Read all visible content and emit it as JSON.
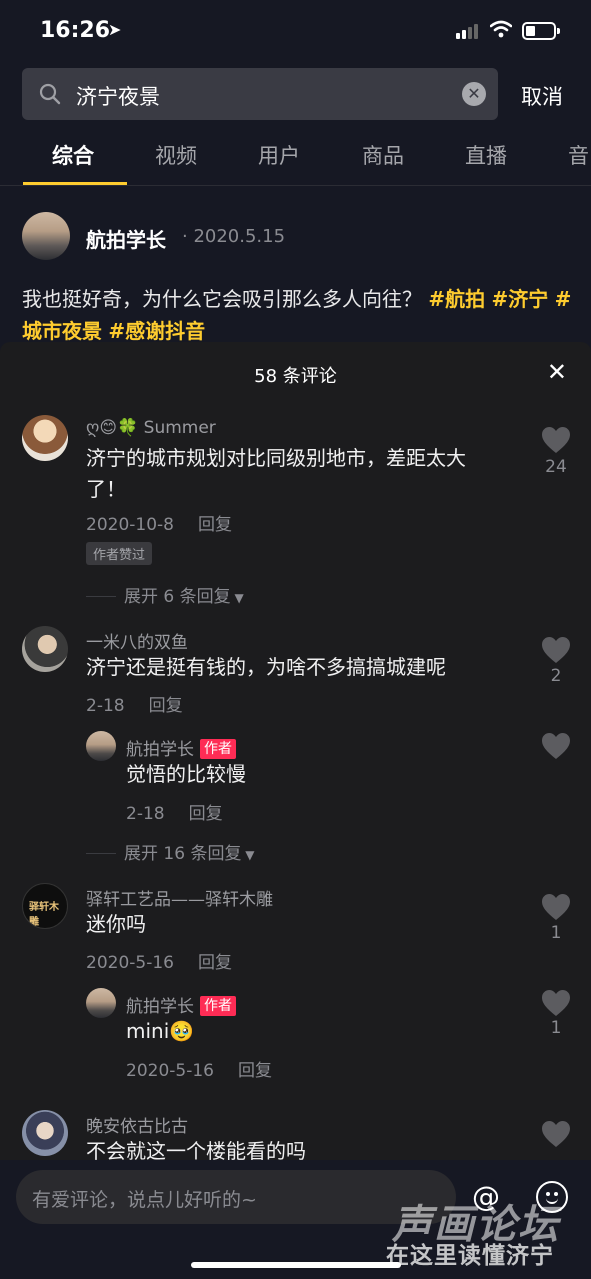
{
  "status_bar": {
    "time": "16:26"
  },
  "search": {
    "query": "济宁夜景",
    "cancel_label": "取消"
  },
  "tabs": [
    {
      "label": "综合",
      "active": true
    },
    {
      "label": "视频"
    },
    {
      "label": "用户"
    },
    {
      "label": "商品"
    },
    {
      "label": "直播"
    },
    {
      "label": "音"
    }
  ],
  "post": {
    "author": "航拍学长",
    "date": "· 2020.5.15",
    "text": "我也挺好奇，为什么它会吸引那么多人向往？",
    "tags": [
      "#航拍",
      "#济宁",
      "#城市夜景",
      "#感谢抖音"
    ]
  },
  "comments_sheet": {
    "title": "58 条评论",
    "comments": [
      {
        "user": "ღ😊🍀 Summer",
        "text_line1": "济宁的城市规划对比同级别地市，差距太大",
        "text_line2": "了！",
        "date": "2020-10-8",
        "reply_label": "回复",
        "badge": "作者赞过",
        "likes": "24",
        "expand": "展开 6 条回复"
      },
      {
        "user": "一米八的双鱼",
        "text": "济宁还是挺有钱的，为啥不多搞搞城建呢",
        "date": "2-18",
        "reply_label": "回复",
        "likes": "2",
        "reply": {
          "user": "航拍学长",
          "author_badge": "作者",
          "text": "觉悟的比较慢",
          "date": "2-18",
          "reply_label": "回复"
        },
        "expand": "展开 16 条回复"
      },
      {
        "user": "驿轩工艺品——驿轩木雕",
        "text": "迷你吗",
        "date": "2020-5-16",
        "reply_label": "回复",
        "likes": "1",
        "reply": {
          "user": "航拍学长",
          "author_badge": "作者",
          "text": "mini🥹",
          "date": "2020-5-16",
          "reply_label": "回复",
          "likes": "1"
        }
      },
      {
        "user": "晚安依古比古",
        "text": "不会就这一个楼能看的吗"
      }
    ]
  },
  "input": {
    "placeholder": "有爱评论，说点儿好听的~"
  },
  "watermark": {
    "line1": "声画论坛",
    "line2": "在这里读懂济宁"
  }
}
